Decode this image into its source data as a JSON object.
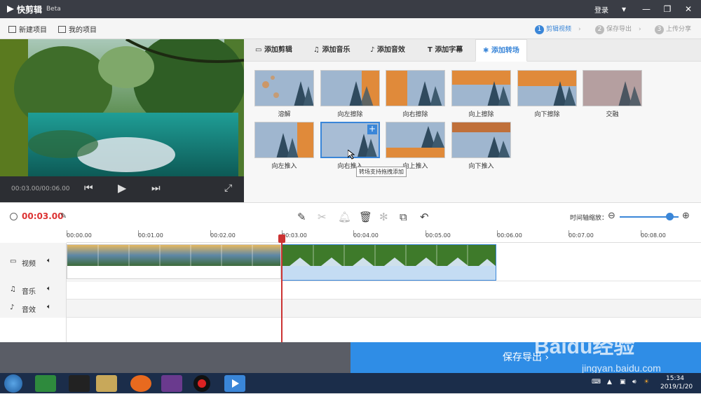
{
  "app": {
    "title": "快剪辑",
    "beta": "Beta",
    "login": "登录"
  },
  "toolbar": {
    "new_project": "新建项目",
    "my_projects": "我的项目",
    "steps": [
      {
        "num": "1",
        "label": "剪辑视频"
      },
      {
        "num": "2",
        "label": "保存导出"
      },
      {
        "num": "3",
        "label": "上传分享"
      }
    ]
  },
  "preview": {
    "time": "00:03.00/00:06.00"
  },
  "tabs": [
    {
      "label": "添加剪辑"
    },
    {
      "label": "添加音乐"
    },
    {
      "label": "添加音效"
    },
    {
      "label": "添加字幕"
    },
    {
      "label": "添加转场"
    }
  ],
  "transitions": [
    {
      "label": "溶解"
    },
    {
      "label": "向左擦除"
    },
    {
      "label": "向右擦除"
    },
    {
      "label": "向上擦除"
    },
    {
      "label": "向下擦除"
    },
    {
      "label": "交融"
    },
    {
      "label": "向左推入"
    },
    {
      "label": "向右推入"
    },
    {
      "label": "向上推入"
    },
    {
      "label": "向下推入"
    }
  ],
  "tooltip": "转场支持拖拽添加",
  "editbar": {
    "current_time": "00:03.00",
    "zoom_label": "时间轴缩放："
  },
  "ruler": [
    "00:00.00",
    "00:01.00",
    "00:02.00",
    "00:03.00",
    "00:04.00",
    "00:05.00",
    "00:06.00",
    "00:07.00",
    "00:08.00"
  ],
  "tracks": {
    "video": "视频",
    "music": "音乐",
    "effects": "音效"
  },
  "export": {
    "label": "保存导出"
  },
  "taskbar": {
    "time": "15:34",
    "date": "2019/1/20"
  },
  "watermark": {
    "main": "Baidu经验",
    "url": "jingyan.baidu.com"
  },
  "colors": {
    "accent": "#3a86d8",
    "export": "#2f8de6",
    "playhead": "#cc3333"
  }
}
